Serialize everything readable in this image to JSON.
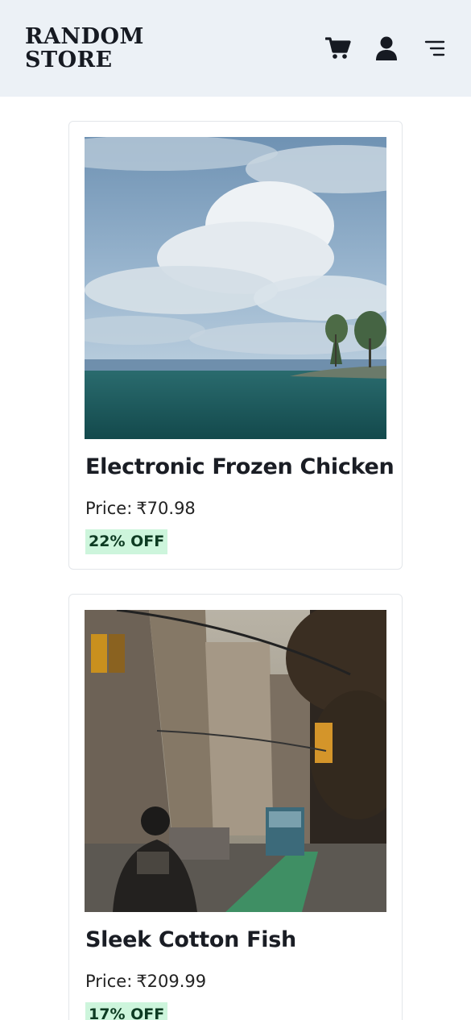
{
  "header": {
    "logo_line1": "Random",
    "logo_line2": "Store",
    "icons": [
      "cart-icon",
      "user-icon",
      "menu-icon"
    ]
  },
  "products": [
    {
      "name": "Electronic Frozen Chicken",
      "price_label": "Price:",
      "price": "₹70.98",
      "discount": "22% OFF",
      "image": "sea-with-clouds-and-trees"
    },
    {
      "name": "Sleek Cotton Fish",
      "price_label": "Price:",
      "price": "₹209.99",
      "discount": "17% OFF",
      "image": "city-street-with-cyclist"
    }
  ],
  "colors": {
    "header_bg": "#ecf1f6",
    "badge_bg": "#cdf5dc",
    "badge_text": "#0d3b22",
    "text": "#1a1d24"
  }
}
